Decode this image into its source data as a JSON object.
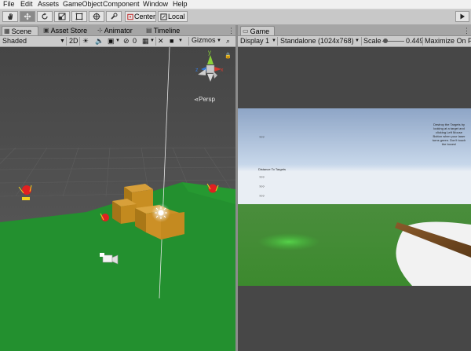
{
  "menu": [
    "File",
    "Edit",
    "Assets",
    "GameObject",
    "Component",
    "Window",
    "Help"
  ],
  "toolbar": {
    "tools": [
      "hand-tool",
      "move-tool",
      "rotate-tool",
      "scale-tool",
      "rect-tool",
      "transform-tool",
      "custom-tool"
    ],
    "pivot_label": "Center",
    "space_label": "Local",
    "play_icon": "play-icon"
  },
  "scene_tabs": {
    "scene": "Scene",
    "asset_store": "Asset Store",
    "animator": "Animator",
    "timeline": "Timeline"
  },
  "scene_toolbar": {
    "draw_mode": "Shaded",
    "mode_2d": "2D",
    "hidden_count": "0",
    "gizmos": "Gizmos"
  },
  "scene_gizmo": {
    "axis_y": "y",
    "axis_x": "x",
    "axis_z": "z",
    "projection": "Persp"
  },
  "game_tab": {
    "label": "Game"
  },
  "game_toolbar": {
    "display": "Display 1",
    "resolution": "Standalone (1024x768)",
    "scale_label": "Scale",
    "scale_value": "0.449",
    "maximize": "Maximize On Pl"
  },
  "game_hud": {
    "top_left": "???",
    "instructions": "Destroy the Targets by\nlooking at a target and\nclicking Left Mouse\nButton when your laser\nturns green. Don't touch\nthe boxes!",
    "distance_label": "Distance To Targets",
    "distance_values": [
      "???",
      "???",
      "???"
    ]
  },
  "colors": {
    "scene_sky_top": "#444444",
    "scene_ground": "#1f8a2c",
    "box": "#c28a1f",
    "game_sky_top": "#8aa3c4",
    "game_ground": "#3a9a37",
    "panel_bg": "#cbcbcb"
  }
}
